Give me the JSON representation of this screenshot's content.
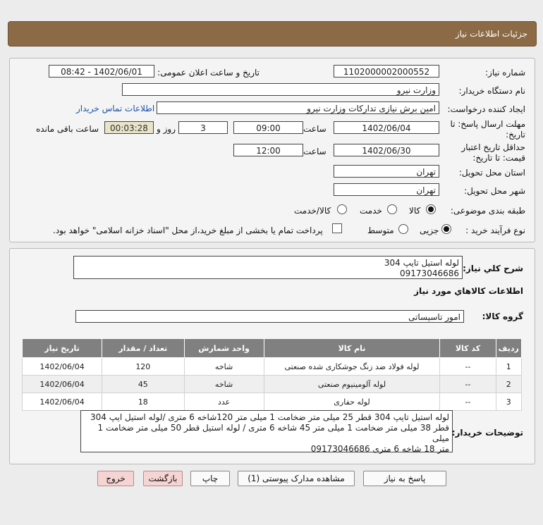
{
  "header": {
    "title": "جزئیات اطلاعات نیاز"
  },
  "form": {
    "need_number_label": "شماره نیاز:",
    "need_number": "1102000002000552",
    "announce_label": "تاریخ و ساعت اعلان عمومی:",
    "announce_value": "1402/06/01 - 08:42",
    "buyer_org_label": "نام دستگاه خریدار:",
    "buyer_org": "وزارت نیرو",
    "requester_label": "ایجاد کننده درخواست:",
    "requester": "امین برش نیازی تدارکات وزارت نیرو",
    "contact_link": "اطلاعات تماس خریدار",
    "deadline_label_1": "مهلت ارسال پاسخ: تا",
    "deadline_label_2": "تاریخ:",
    "deadline_date": "1402/06/04",
    "time_label": "ساعت",
    "deadline_time": "09:00",
    "days_value": "3",
    "days_label": "روز و",
    "remaining_value": "00:03:28",
    "remaining_label": "ساعت باقی مانده",
    "validity_label_1": "حداقل تاریخ اعتبار",
    "validity_label_2": "قیمت: تا تاریخ:",
    "validity_date": "1402/06/30",
    "validity_time": "12:00",
    "province_label": "استان محل تحویل:",
    "province": "تهران",
    "city_label": "شهر محل تحویل:",
    "city": "تهران",
    "category_label": "طبقه بندی موضوعی:",
    "category_options": [
      "کالا",
      "خدمت",
      "کالا/خدمت"
    ],
    "purchase_type_label": "نوع فرآیند خرید :",
    "purchase_options": [
      "جزیی",
      "متوسط"
    ],
    "payment_note": "پرداخت تمام یا بخشی از مبلغ خرید،از محل \"اسناد خزانه اسلامی\" خواهد بود."
  },
  "summary": {
    "label": "شرح کلي نياز:",
    "line1": "لوله استیل تایپ 304",
    "line2": "09173046686"
  },
  "goods": {
    "section_title": "اطلاعات کالاهاي مورد نياز",
    "group_label": "گروه کالا:",
    "group_value": "امور تاسیساتی",
    "columns": [
      "ردیف",
      "کد کالا",
      "نام کالا",
      "واحد شمارش",
      "تعداد / مقدار",
      "تاریخ نیاز"
    ],
    "rows": [
      [
        "1",
        "--",
        "لوله فولاد ضد زنگ جوشکاری شده صنعتی",
        "شاخه",
        "120",
        "1402/06/04"
      ],
      [
        "2",
        "--",
        "لوله آلومینیوم صنعتی",
        "شاخه",
        "45",
        "1402/06/04"
      ],
      [
        "3",
        "--",
        "لوله حفاری",
        "عدد",
        "18",
        "1402/06/04"
      ]
    ]
  },
  "buyer_notes": {
    "label": "توضیحات خریدار:",
    "line1": "لوله استیل تایپ 304 قطر 25 میلی متر ضخامت 1 میلی متر 120شاخه 6 متری /لوله استیل ایپ 304",
    "line2": "قطر 38 میلی متر ضخامت 1 میلی متر 45 شاخه 6 متری / لوله استیل قطر 50 میلی متر ضخامت 1 میلی",
    "line3": "متر 18 شاخه 6 متری 09173046686"
  },
  "buttons": {
    "reply": "پاسخ به نیاز",
    "attachments": "مشاهده مدارک پیوستی (1)",
    "print": "چاپ",
    "back": "بازگشت",
    "exit": "خروج"
  }
}
